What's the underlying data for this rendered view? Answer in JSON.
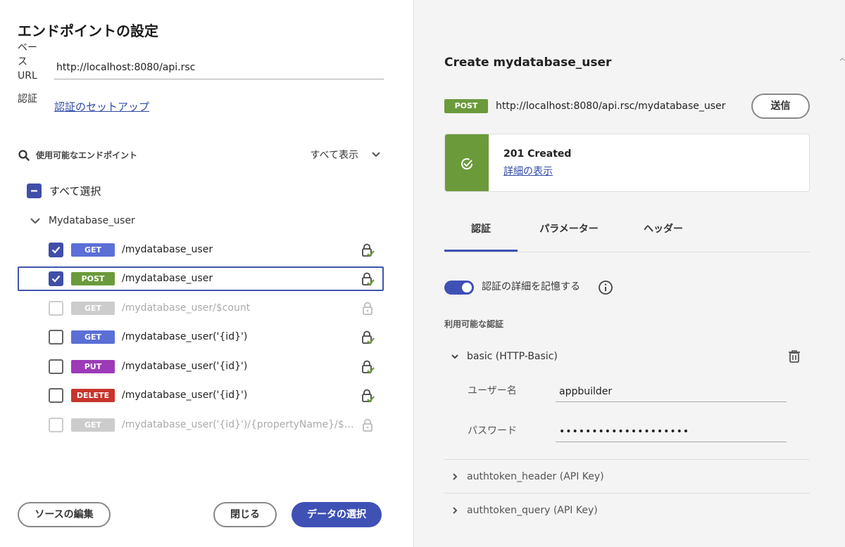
{
  "left": {
    "title": "エンドポイントの設定",
    "base_url_label": "ベース URL",
    "base_url_value": "http://localhost:8080/api.rsc",
    "auth_label": "認証",
    "auth_link": "認証のセットアップ",
    "search_label": "使用可能なエンドポイント",
    "show_all": "すべて表示",
    "select_all": "すべて選択",
    "group_name": "Mydatabase_user",
    "endpoints": [
      {
        "method": "GET",
        "path": "/mydatabase_user",
        "checked": true,
        "disabled": false
      },
      {
        "method": "POST",
        "path": "/mydatabase_user",
        "checked": true,
        "disabled": false,
        "selected": true
      },
      {
        "method": "GET",
        "path": "/mydatabase_user/$count",
        "checked": false,
        "disabled": true
      },
      {
        "method": "GET",
        "path": "/mydatabase_user('{id}')",
        "checked": false,
        "disabled": false
      },
      {
        "method": "PUT",
        "path": "/mydatabase_user('{id}')",
        "checked": false,
        "disabled": false
      },
      {
        "method": "DELETE",
        "path": "/mydatabase_user('{id}')",
        "checked": false,
        "disabled": false
      },
      {
        "method": "GET",
        "path": "/mydatabase_user('{id}')/{propertyName}/$value",
        "checked": false,
        "disabled": true
      }
    ],
    "edit_source": "ソースの編集",
    "close": "閉じる",
    "select_data": "データの選択"
  },
  "right": {
    "title": "Create mydatabase_user",
    "method": "POST",
    "url": "http://localhost:8080/api.rsc/mydatabase_user",
    "send": "送信",
    "status_code": "201 Created",
    "status_link": "詳細の表示",
    "tabs": [
      "認証",
      "パラメーター",
      "ヘッダー"
    ],
    "remember_label": "認証の詳細を記憶する",
    "available_auth": "利用可能な認証",
    "auth_basic": "basic (HTTP-Basic)",
    "username_label": "ユーザー名",
    "username_value": "appbuilder",
    "password_label": "パスワード",
    "password_value": "••••••••••••••••••••",
    "auth_header": "authtoken_header (API Key)",
    "auth_query": "authtoken_query (API Key)"
  },
  "colors": {
    "primary": "#3f51b5",
    "get": "#5b6fd6",
    "post": "#6b9a3b",
    "put": "#9c3ab8",
    "delete": "#c8342c",
    "disabled": "#cccccc"
  }
}
